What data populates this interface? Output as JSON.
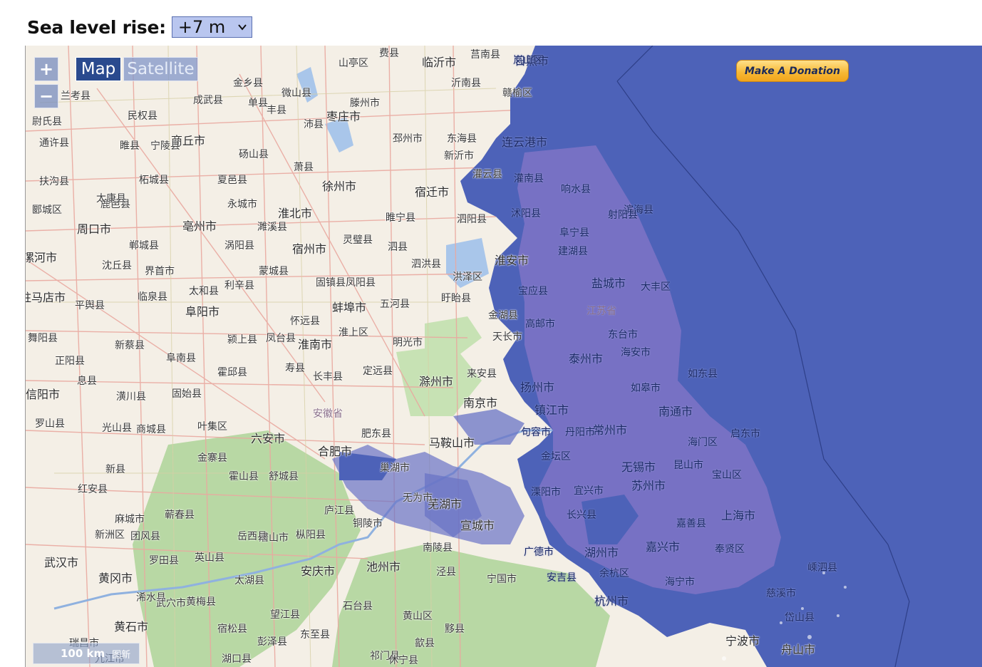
{
  "header": {
    "label": "Sea level rise:",
    "select_value": "+7 m"
  },
  "map": {
    "zoom_in": "+",
    "zoom_out": "−",
    "map_button": "Map",
    "satellite_button": "Satellite",
    "donate_button": "Make A Donation",
    "scale_text": "100 km",
    "scale_attr": "图新",
    "colors": {
      "flood": "#4d62b8",
      "land": "#f4efe6",
      "forest": "#b8d8a4",
      "road": "#e9a9a0",
      "river": "#a9c6ea"
    },
    "labels": [
      "日照市",
      "临沂市",
      "莒南县",
      "岚山区",
      "山亭区",
      "费县",
      "沂南县",
      "赣榆区",
      "连云港市",
      "东海县",
      "新沂市",
      "灌云县",
      "灌南县",
      "响水县",
      "宿迁市",
      "徐州市",
      "睢宁县",
      "泗阳县",
      "沭阳县",
      "滨海县",
      "阜宁县",
      "射阳县",
      "建湖县",
      "淮安市",
      "盐城市",
      "大丰区",
      "宝应县",
      "金湖县",
      "高邮市",
      "江苏省",
      "东台市",
      "海安市",
      "泰州市",
      "如东县",
      "如皋市",
      "南通市",
      "启东市",
      "海门区",
      "扬州市",
      "镇江市",
      "常州市",
      "无锡市",
      "苏州市",
      "宝山区",
      "上海市",
      "昆山市",
      "嘉兴市",
      "奉贤区",
      "湖州市",
      "杭州市",
      "海宁市",
      "嘉善县",
      "嵊泗县",
      "岱山县",
      "舟山市",
      "宁波市",
      "慈溪市",
      "余杭区",
      "长兴县",
      "安吉县",
      "宜兴市",
      "溧阳市",
      "金坛区",
      "丹阳市",
      "句容市",
      "南京市",
      "马鞍山市",
      "芜湖市",
      "宣城市",
      "铜陵市",
      "池州市",
      "安庆市",
      "广德市",
      "南陵县",
      "泾县",
      "宁国市",
      "合肥市",
      "六安市",
      "淮南市",
      "蚌埠市",
      "宿州市",
      "淮北市",
      "亳州市",
      "阜阳市",
      "周口市",
      "商丘市",
      "枣庄市",
      "滁州市",
      "来安县",
      "天长市",
      "明光市",
      "五河县",
      "泗洪县",
      "洪泽区",
      "盱眙县",
      "凤阳县",
      "定远县",
      "长丰县",
      "寿县",
      "霍邱县",
      "金寨县",
      "舒城县",
      "庐江县",
      "肥东县",
      "巢湖市",
      "无为市",
      "枞阳县",
      "太湖县",
      "潜山市",
      "岳西县",
      "英山县",
      "罗田县",
      "黄冈市",
      "武汉市",
      "黄石市",
      "浠水县",
      "宿松县",
      "望江县",
      "东至县",
      "彭泽县",
      "石台县",
      "黄山区",
      "祁门县",
      "休宁县",
      "黟县",
      "歙县",
      "安徽省",
      "临泉县",
      "太和县",
      "界首市",
      "沈丘县",
      "郸城县",
      "鹿邑县",
      "涡阳县",
      "蒙城县",
      "利辛县",
      "颍上县",
      "阜南县",
      "固始县",
      "商城县",
      "新县",
      "光山县",
      "潢川县",
      "信阳市",
      "罗山县",
      "息县",
      "正阳县",
      "新蔡县",
      "平舆县",
      "驻马店市",
      "漯河市",
      "扶沟县",
      "太康县",
      "柘城县",
      "永城市",
      "夏邑县",
      "砀山县",
      "萧县",
      "丰县",
      "沛县",
      "微山县",
      "滕州市",
      "邳州市",
      "睢宁县",
      "灵璧县",
      "泗县",
      "固镇县",
      "怀远县",
      "凤台县",
      "淮上区",
      "濉溪县",
      "金乡县",
      "成武县",
      "单县",
      "兰考县",
      "民权县",
      "宁陵县",
      "睢县",
      "通许县",
      "尉氏县",
      "郾城区",
      "舞阳县",
      "叶集区",
      "霍山县",
      "红安县",
      "麻城市",
      "新洲区",
      "团风县",
      "蕲春县",
      "武穴市",
      "黄梅县",
      "瑞昌市",
      "九江市",
      "湖口县"
    ]
  }
}
